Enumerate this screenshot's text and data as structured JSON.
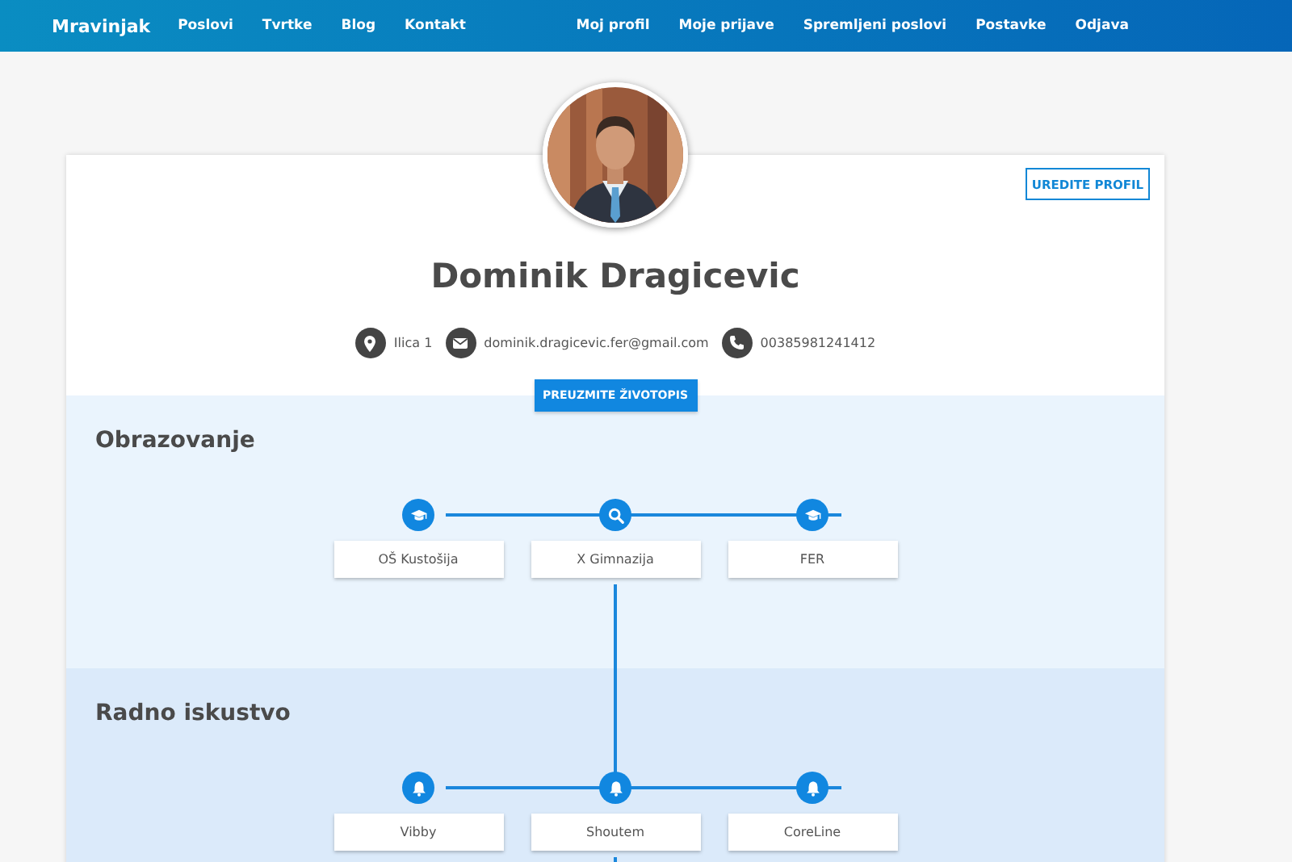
{
  "navbar": {
    "brand": "Mravinjak",
    "left_links": [
      "Poslovi",
      "Tvrtke",
      "Blog",
      "Kontakt"
    ],
    "right_links": [
      "Moj profil",
      "Moje prijave",
      "Spremljeni poslovi",
      "Postavke",
      "Odjava"
    ]
  },
  "profile": {
    "edit_button": "UREDITE PROFIL",
    "name": "Dominik Dragicevic",
    "contacts": [
      {
        "kind": "location",
        "text": "Ilica 1"
      },
      {
        "kind": "email",
        "text": "dominik.dragicevic.fer@gmail.com"
      },
      {
        "kind": "phone",
        "text": "00385981241412"
      }
    ],
    "download_button": "PREUZMITE ŽIVOTOPIS"
  },
  "sections": [
    {
      "title": "Obrazovanje",
      "items": [
        {
          "kind": "school",
          "label": "OŠ Kustošija"
        },
        {
          "kind": "current",
          "label": "X Gimnazija"
        },
        {
          "kind": "school",
          "label": "FER"
        }
      ]
    },
    {
      "title": "Radno iskustvo",
      "items": [
        {
          "kind": "job",
          "label": "Vibby"
        },
        {
          "kind": "job",
          "label": "Shoutem"
        },
        {
          "kind": "job",
          "label": "CoreLine"
        }
      ]
    }
  ]
}
